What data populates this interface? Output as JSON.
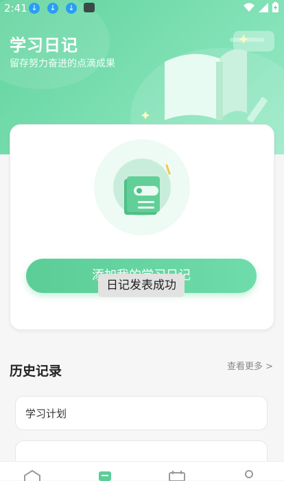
{
  "status": {
    "time": "2:41"
  },
  "header": {
    "title": "学习日记",
    "subtitle": "留存努力奋进的点滴成果"
  },
  "card": {
    "add_button_label": "添加我的学习日记"
  },
  "toast": {
    "text": "日记发表成功"
  },
  "history": {
    "title": "历史记录",
    "more_label": "查看更多 >",
    "items": [
      {
        "label": "学习计划"
      },
      {
        "label": ""
      }
    ]
  },
  "colors": {
    "accent": "#5ccd97",
    "hero": "#6fd8a8"
  }
}
